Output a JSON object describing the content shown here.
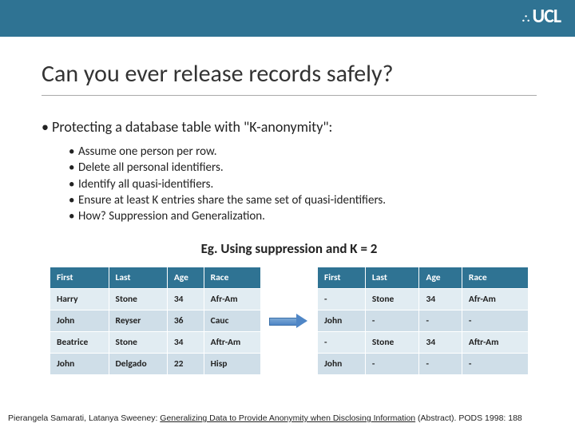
{
  "header": {
    "logo_text": "UCL"
  },
  "title": "Can you ever release records safely?",
  "main_bullet": "Protecting a database table with \"K-anonymity\":",
  "sub_bullets": [
    "Assume one person per row.",
    "Delete all personal identifiers.",
    "Identify all quasi-identifiers.",
    "Ensure at least K entries share the same set of quasi-identifiers.",
    "How? Suppression and Generalization."
  ],
  "example_line": "Eg. Using suppression and K = 2",
  "table_left": {
    "headers": [
      "First",
      "Last",
      "Age",
      "Race"
    ],
    "rows": [
      [
        "Harry",
        "Stone",
        "34",
        "Afr-Am"
      ],
      [
        "John",
        "Reyser",
        "36",
        "Cauc"
      ],
      [
        "Beatrice",
        "Stone",
        "34",
        "Aftr-Am"
      ],
      [
        "John",
        "Delgado",
        "22",
        "Hisp"
      ]
    ]
  },
  "table_right": {
    "headers": [
      "First",
      "Last",
      "Age",
      "Race"
    ],
    "rows": [
      [
        "-",
        "Stone",
        "34",
        "Afr-Am"
      ],
      [
        "John",
        "-",
        "-",
        "-"
      ],
      [
        "-",
        "Stone",
        "34",
        "Aftr-Am"
      ],
      [
        "John",
        "-",
        "-",
        "-"
      ]
    ]
  },
  "citation": {
    "authors": "Pierangela Samarati, Latanya Sweeney: ",
    "title": "Generalizing Data to Provide Anonymity when Disclosing Information",
    "venue": " (Abstract). PODS 1998: 188"
  }
}
